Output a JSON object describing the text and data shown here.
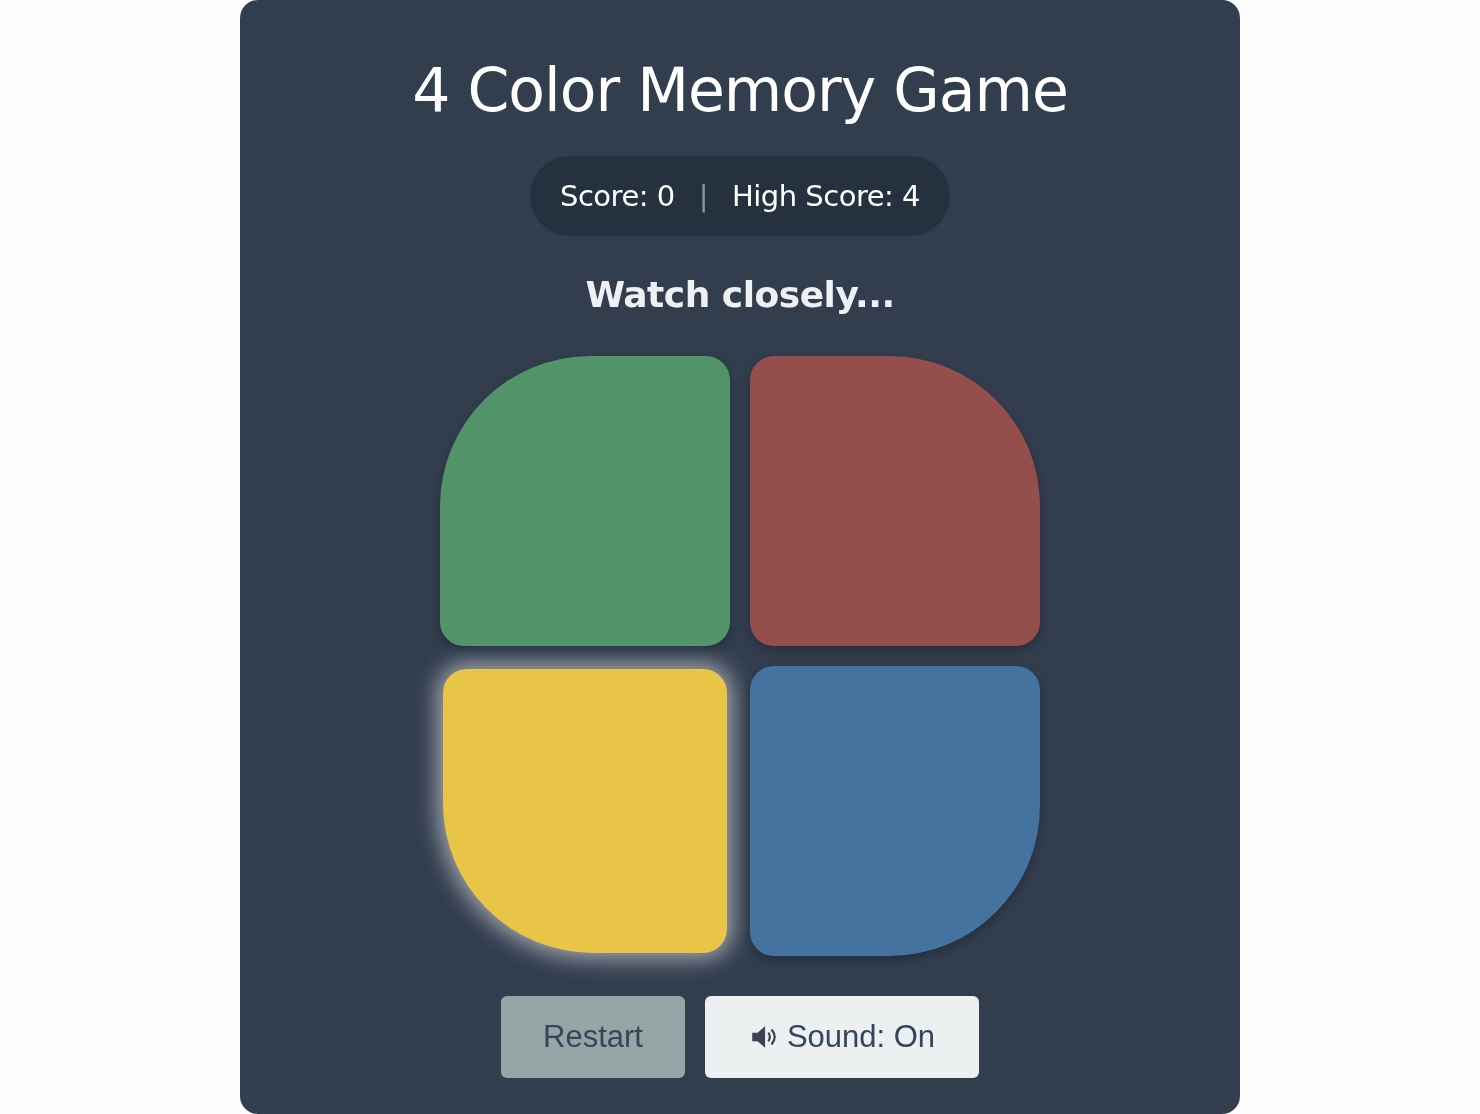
{
  "title": "4 Color Memory Game",
  "scoreboard": {
    "score": "Score: 0",
    "separator": "|",
    "high_score": "High Score: 4"
  },
  "status": "Watch closely...",
  "pads": [
    {
      "color": "#52936a",
      "lit": false
    },
    {
      "color": "#944f4d",
      "lit": false
    },
    {
      "color": "#e8c547",
      "lit": true
    },
    {
      "color": "#44739f",
      "lit": false
    }
  ],
  "buttons": [
    {
      "kind": "restart",
      "label": "Restart"
    },
    {
      "kind": "sound",
      "label": "Sound: On",
      "on": true
    }
  ]
}
